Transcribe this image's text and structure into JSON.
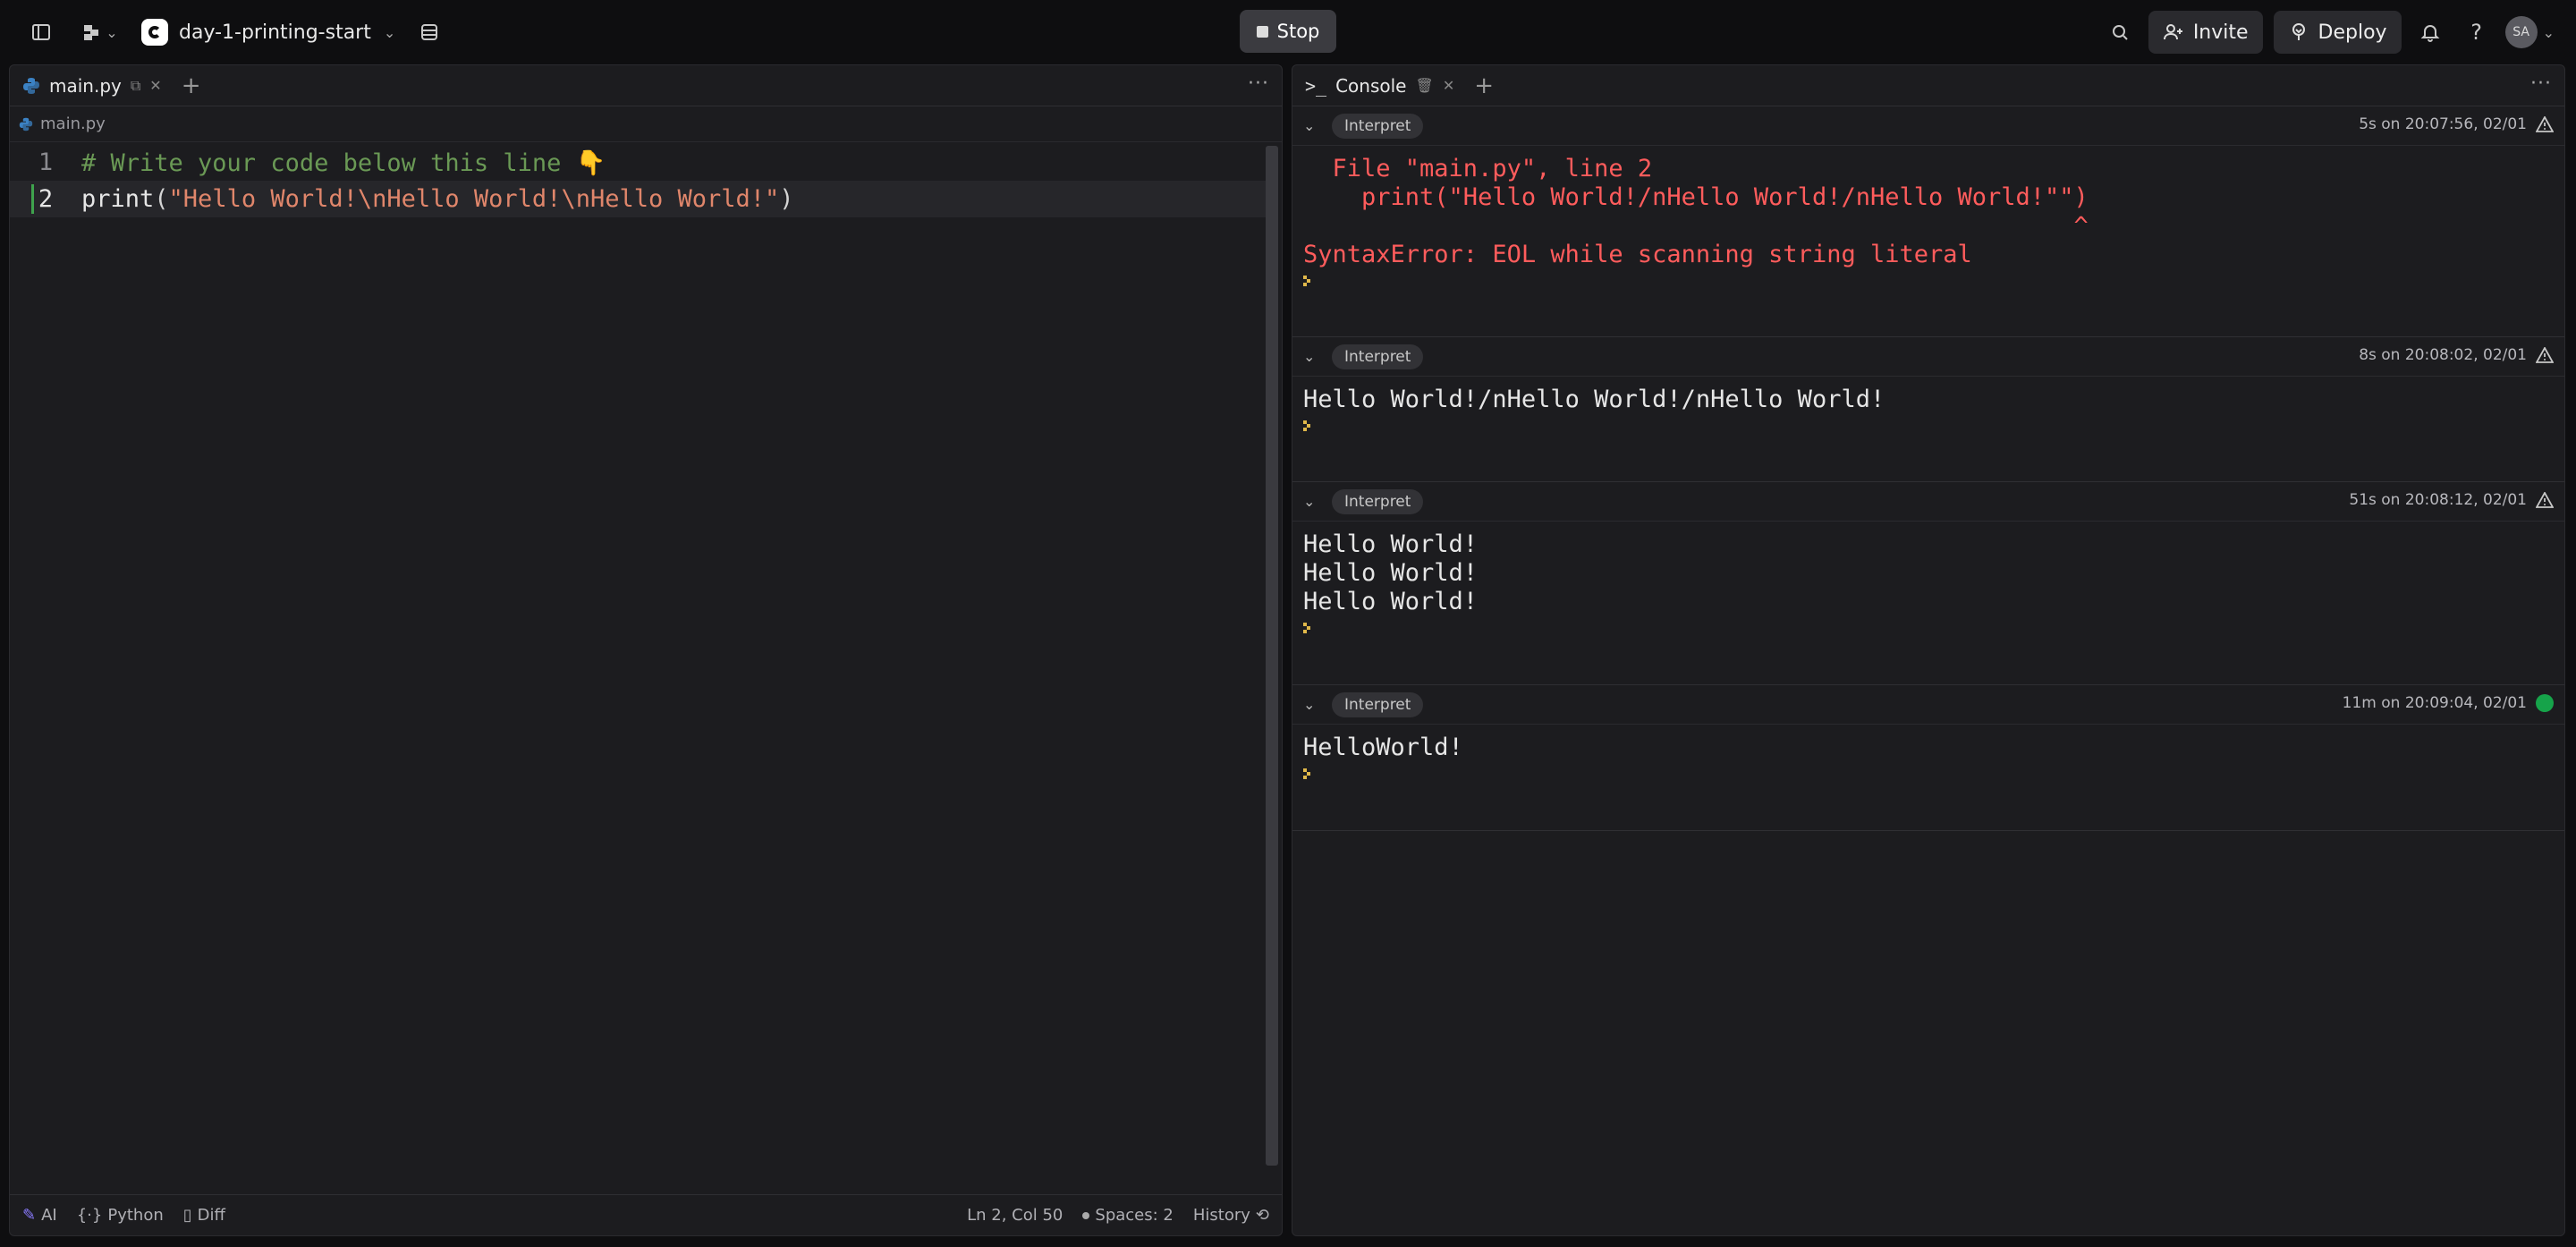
{
  "topbar": {
    "project_name": "day-1-printing-start",
    "stop_label": "Stop",
    "invite_label": "Invite",
    "deploy_label": "Deploy",
    "avatar_initials": "SA"
  },
  "editor": {
    "tab_label": "main.py",
    "breadcrumb": "main.py",
    "lines": [
      {
        "num": "1",
        "comment": "# Write your code below this line 👇"
      },
      {
        "num": "2",
        "fn": "print",
        "open": "(",
        "str": "\"Hello World!\\nHello World!\\nHello World!\"",
        "close": ")"
      }
    ],
    "status": {
      "ai": "AI",
      "language": "Python",
      "diff": "Diff",
      "cursor": "Ln 2, Col 50",
      "spaces": "Spaces: 2",
      "history": "History"
    }
  },
  "console": {
    "tab_label": "Console",
    "blocks": [
      {
        "label": "Interpret",
        "meta": "5s on 20:07:56, 02/01",
        "status": "warning",
        "kind": "err",
        "output": "  File \"main.py\", line 2\n    print(\"Hello World!/nHello World!/nHello World!\"\")\n                                                     ^\nSyntaxError: EOL while scanning string literal"
      },
      {
        "label": "Interpret",
        "meta": "8s on 20:08:02, 02/01",
        "status": "warning",
        "kind": "norm",
        "output": "Hello World!/nHello World!/nHello World!"
      },
      {
        "label": "Interpret",
        "meta": "51s on 20:08:12, 02/01",
        "status": "warning",
        "kind": "norm",
        "output": "Hello World!\nHello World!\nHello World!"
      },
      {
        "label": "Interpret",
        "meta": "11m on 20:09:04, 02/01",
        "status": "success",
        "kind": "norm",
        "output": "HelloWorld!"
      }
    ]
  },
  "colors": {
    "success": "#16a34a",
    "error": "#ff5c5c",
    "prompt": "#e0b84a"
  }
}
